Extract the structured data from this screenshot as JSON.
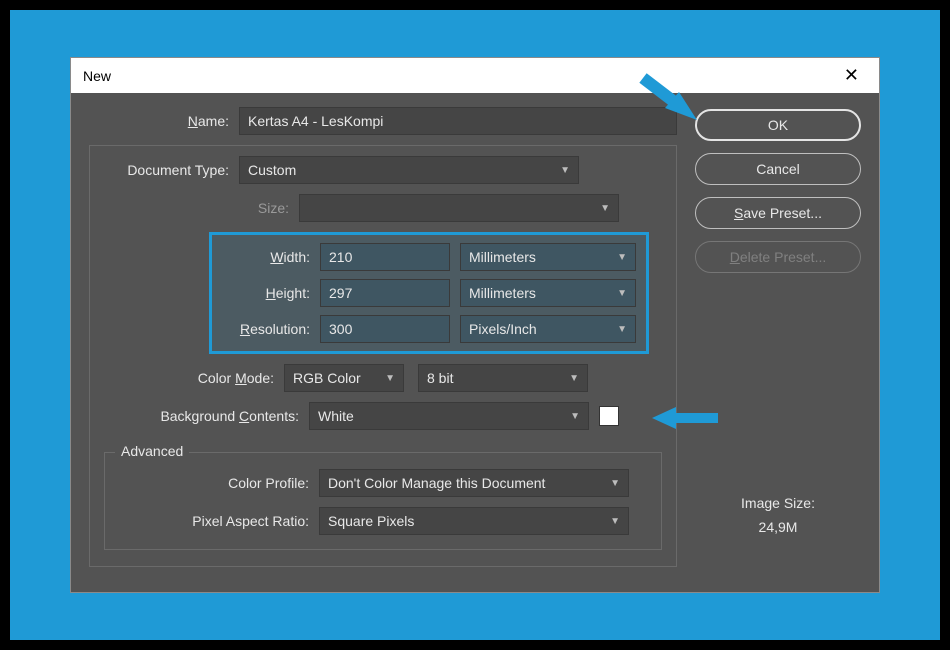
{
  "title": "New",
  "name": {
    "label_prefix": "N",
    "label_rest": "ame:",
    "value": "Kertas A4 - LesKompi"
  },
  "docType": {
    "label": "Document Type:",
    "value": "Custom"
  },
  "size": {
    "label_prefix": "S",
    "label_rest": "ize:",
    "value": ""
  },
  "width": {
    "label_prefix": "W",
    "label_rest": "idth:",
    "value": "210",
    "unit": "Millimeters"
  },
  "height": {
    "label_prefix": "H",
    "label_rest": "eight:",
    "value": "297",
    "unit": "Millimeters"
  },
  "resolution": {
    "label_prefix": "R",
    "label_rest": "esolution:",
    "value": "300",
    "unit": "Pixels/Inch"
  },
  "colorMode": {
    "label_pre": "Color ",
    "label_ul": "M",
    "label_post": "ode:",
    "value": "RGB Color",
    "depth": "8 bit"
  },
  "background": {
    "label_pre": "Background ",
    "label_ul": "C",
    "label_post": "ontents:",
    "value": "White",
    "swatch": "#ffffff"
  },
  "advanced": {
    "legend": "Advanced",
    "colorProfile": {
      "label": "Color Profile:",
      "value": "Don't Color Manage this Document"
    },
    "pixelAspect": {
      "label": "Pixel Aspect Ratio:",
      "value": "Square Pixels"
    }
  },
  "buttons": {
    "ok": "OK",
    "cancel": "Cancel",
    "savePreset_ul": "S",
    "savePreset_rest": "ave Preset...",
    "deletePreset_ul": "D",
    "deletePreset_rest": "elete Preset..."
  },
  "imageSize": {
    "title": "Image Size:",
    "value": "24,9M"
  },
  "colors": {
    "accent": "#1f9ad6"
  }
}
